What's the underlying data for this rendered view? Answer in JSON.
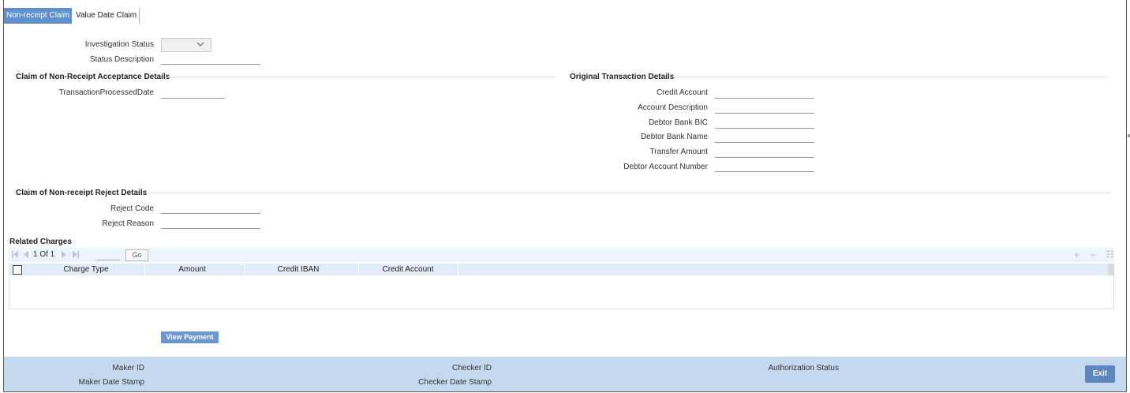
{
  "tabs": [
    {
      "label": "Non-receipt Claim",
      "active": true
    },
    {
      "label": "Value Date Claim",
      "active": false
    }
  ],
  "investigation": {
    "status_label": "Investigation Status",
    "status_value": "",
    "description_label": "Status Description",
    "description_value": ""
  },
  "acceptance": {
    "title": "Claim of Non-Receipt Acceptance Details",
    "processed_date_label": "TransactionProcessedDate",
    "processed_date_value": ""
  },
  "original": {
    "title": "Original Transaction Details",
    "fields": [
      {
        "label": "Credit Account",
        "value": ""
      },
      {
        "label": "Account Description",
        "value": ""
      },
      {
        "label": "Debtor Bank BIC",
        "value": ""
      },
      {
        "label": "Debtor Bank Name",
        "value": ""
      },
      {
        "label": "Transfer Amount",
        "value": ""
      },
      {
        "label": "Debtor Account Number",
        "value": ""
      }
    ]
  },
  "reject": {
    "title": "Claim of Non-receipt Reject Details",
    "code_label": "Reject Code",
    "code_value": "",
    "reason_label": "Reject Reason",
    "reason_value": ""
  },
  "charges": {
    "title": "Related Charges",
    "pager_text": "1 Of 1",
    "go_label": "Go",
    "columns": [
      "Charge Type",
      "Amount",
      "Credit IBAN",
      "Credit Account"
    ],
    "tools": {
      "add": "+",
      "remove": "−",
      "list": "☷"
    }
  },
  "buttons": {
    "view_payment": "View Payment",
    "exit": "Exit"
  },
  "audit": {
    "maker_id_label": "Maker ID",
    "maker_date_label": "Maker Date Stamp",
    "checker_id_label": "Checker ID",
    "checker_date_label": "Checker Date Stamp",
    "auth_status_label": "Authorization Status"
  },
  "colors": {
    "tab_active": "#5f8fcc",
    "footer": "#c5d9ee",
    "button": "#6b98d2",
    "grid_header": "#e1ecf8"
  }
}
